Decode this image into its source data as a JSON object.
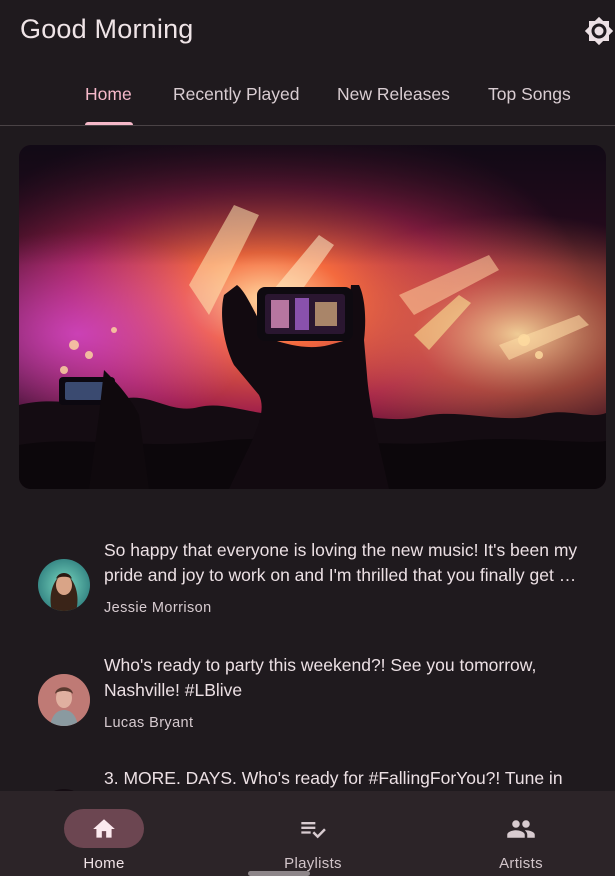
{
  "header": {
    "title": "Good Morning",
    "theme_icon": "brightness-icon"
  },
  "tabs": [
    {
      "label": "Home",
      "active": true
    },
    {
      "label": "Recently Played",
      "active": false
    },
    {
      "label": "New Releases",
      "active": false
    },
    {
      "label": "Top Songs",
      "active": false
    }
  ],
  "hero": {
    "image": "concert-crowd-photo"
  },
  "feed": [
    {
      "text": "So happy that everyone is loving the new music! It's been my pride and joy to work on and I'm thrilled that you finally get to hear it.",
      "author": "Jessie Morrison"
    },
    {
      "text": "Who's ready to party this weekend?! See you tomorrow, Nashville! #LBlive",
      "author": "Lucas Bryant"
    },
    {
      "text": "3. MORE. DAYS. Who's ready for #FallingForYou?! Tune in"
    }
  ],
  "bottom_nav": [
    {
      "label": "Home",
      "icon": "home-icon",
      "active": true
    },
    {
      "label": "Playlists",
      "icon": "playlist-check-icon",
      "active": false
    },
    {
      "label": "Artists",
      "icon": "people-icon",
      "active": false
    }
  ],
  "colors": {
    "background": "#1f1a1e",
    "accent": "#f5b8c9",
    "nav_background": "#2c2428",
    "active_pill": "#6c4651"
  }
}
